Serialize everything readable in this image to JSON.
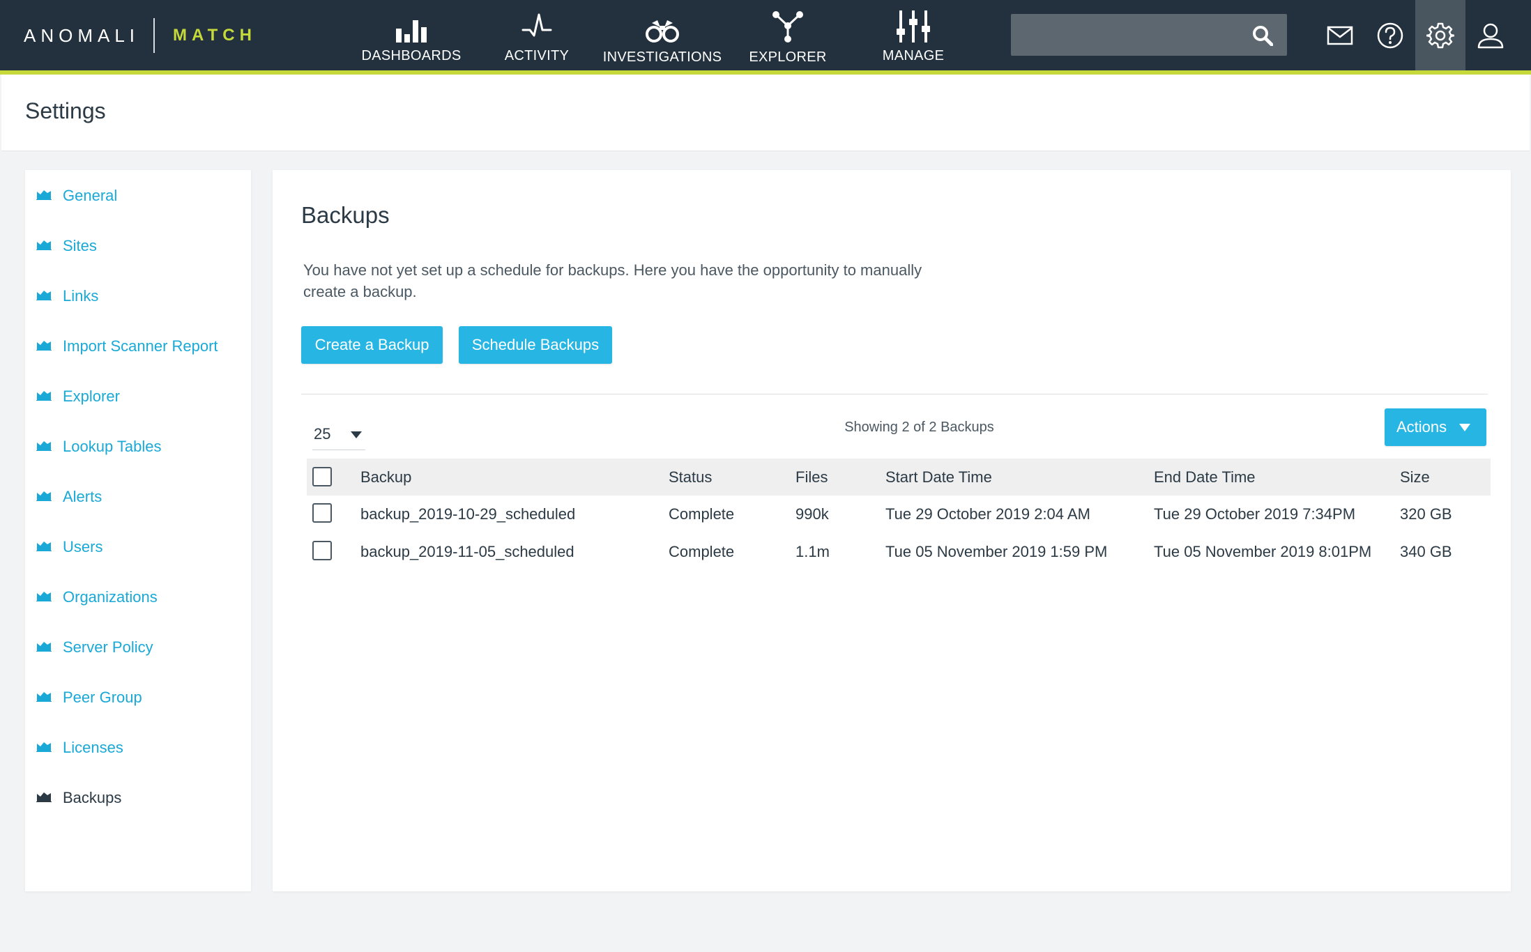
{
  "brand": {
    "name": "ANOMALI",
    "product": "MATCH"
  },
  "nav": [
    {
      "id": "dashboards",
      "label": "DASHBOARDS",
      "icon": "bar-chart-icon"
    },
    {
      "id": "activity",
      "label": "ACTIVITY",
      "icon": "pulse-icon"
    },
    {
      "id": "investigations",
      "label": "INVESTIGATIONS",
      "icon": "binoculars-icon"
    },
    {
      "id": "explorer",
      "label": "EXPLORER",
      "icon": "network-icon"
    },
    {
      "id": "manage",
      "label": "MANAGE",
      "icon": "sliders-icon"
    }
  ],
  "search": {
    "placeholder": "",
    "value": ""
  },
  "top_icons": [
    "mail-icon",
    "help-icon",
    "gear-icon",
    "user-icon"
  ],
  "page": {
    "title": "Settings"
  },
  "sidebar": {
    "items": [
      {
        "label": "General"
      },
      {
        "label": "Sites"
      },
      {
        "label": "Links"
      },
      {
        "label": "Import Scanner Report"
      },
      {
        "label": "Explorer"
      },
      {
        "label": "Lookup Tables"
      },
      {
        "label": "Alerts"
      },
      {
        "label": "Users"
      },
      {
        "label": "Organizations"
      },
      {
        "label": "Server Policy"
      },
      {
        "label": "Peer Group"
      },
      {
        "label": "Licenses"
      },
      {
        "label": "Backups",
        "active": true
      }
    ]
  },
  "main": {
    "title": "Backups",
    "description": "You have not yet set up a schedule for backups. Here you have the opportunity to manually create a backup.",
    "create_label": "Create a Backup",
    "schedule_label": "Schedule Backups",
    "page_size": "25",
    "showing": "Showing 2 of 2 Backups",
    "actions_label": "Actions"
  },
  "table": {
    "headers": {
      "backup": "Backup",
      "status": "Status",
      "files": "Files",
      "start": "Start Date Time",
      "end": "End Date Time",
      "size": "Size"
    },
    "rows": [
      {
        "backup": "backup_2019-10-29_scheduled",
        "status": "Complete",
        "files": "990k",
        "start": "Tue 29 October 2019 2:04 AM",
        "end": "Tue 29 October 2019 7:34PM",
        "size": "320 GB"
      },
      {
        "backup": "backup_2019-11-05_scheduled",
        "status": "Complete",
        "files": "1.1m",
        "start": "Tue 05 November 2019 1:59 PM",
        "end": "Tue 05 November 2019 8:01PM",
        "size": "340 GB"
      }
    ]
  },
  "colors": {
    "nav_bg": "#22313d",
    "accent_bar": "#c6d93b",
    "link": "#1aa9d6",
    "button": "#27b6e3"
  }
}
